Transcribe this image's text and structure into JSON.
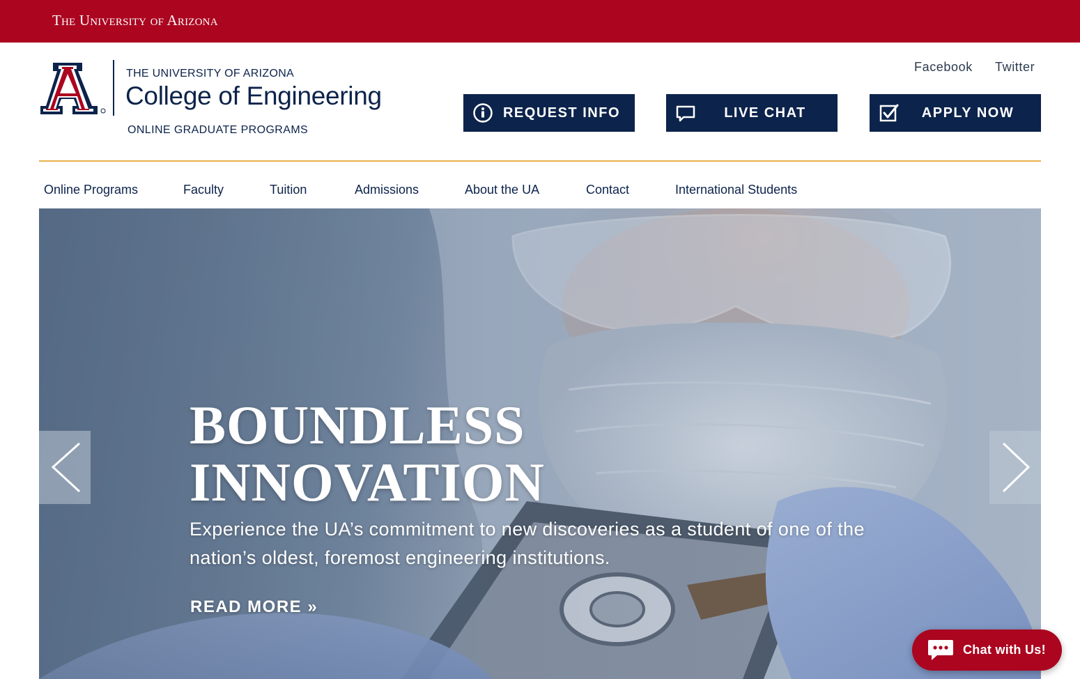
{
  "topbar": {
    "title": "The University of Arizona"
  },
  "brand": {
    "university": "THE UNIVERSITY OF ARIZONA",
    "college": "College of Engineering",
    "subtitle": "ONLINE GRADUATE PROGRAMS",
    "logo_icon": "block-a-logo-icon"
  },
  "social": {
    "facebook": "Facebook",
    "twitter": "Twitter"
  },
  "cta": {
    "request": {
      "label": "REQUEST INFO",
      "icon": "info-icon"
    },
    "chat": {
      "label": "LIVE CHAT",
      "icon": "chat-bubble-icon"
    },
    "apply": {
      "label": "APPLY NOW",
      "icon": "checkbox-icon"
    }
  },
  "nav": {
    "items": [
      {
        "label": "Online Programs"
      },
      {
        "label": "Faculty"
      },
      {
        "label": "Tuition"
      },
      {
        "label": "Admissions"
      },
      {
        "label": "About the UA"
      },
      {
        "label": "Contact"
      },
      {
        "label": "International Students"
      }
    ]
  },
  "hero": {
    "title_line1": "BOUNDLESS",
    "title_line2": "INNOVATION",
    "text": "Experience the UA’s commitment to new discoveries as a student of one of the nation’s oldest, foremost engineering institutions.",
    "read_more": "READ MORE »"
  },
  "chat_widget": {
    "label": "Chat with Us!",
    "icon": "chat-dots-icon"
  },
  "colors": {
    "brand_red": "#ab0520",
    "brand_navy": "#0c234b",
    "accent_gold": "#e8b14a"
  }
}
